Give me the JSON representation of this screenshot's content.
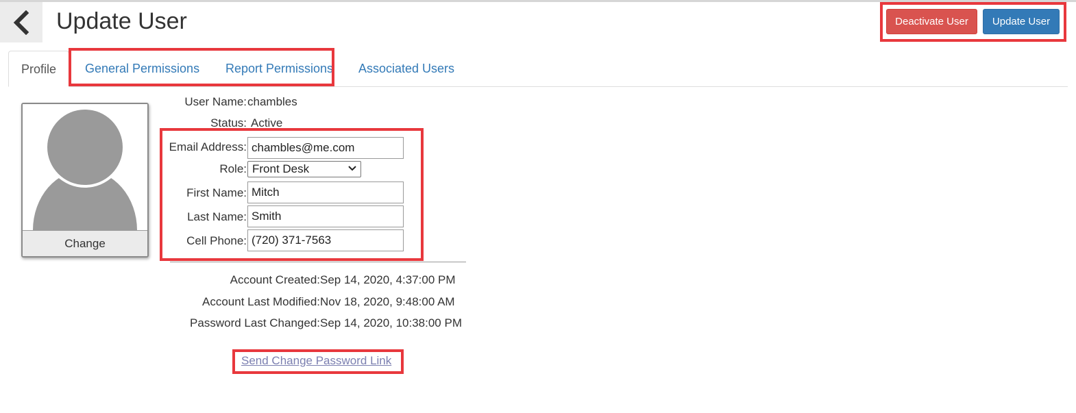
{
  "header": {
    "title": "Update User",
    "deactivate_label": "Deactivate User",
    "update_label": "Update User"
  },
  "tabs": [
    {
      "label": "Profile",
      "active": true
    },
    {
      "label": "General Permissions",
      "active": false
    },
    {
      "label": "Report Permissions",
      "active": false
    },
    {
      "label": "Associated Users",
      "active": false
    }
  ],
  "avatar": {
    "change_label": "Change"
  },
  "profile": {
    "username_label": "User Name:",
    "username": "chambles",
    "status_label": "Status:",
    "status": "Active",
    "email_label": "Email Address:",
    "email": "chambles@me.com",
    "role_label": "Role:",
    "role": "Front Desk",
    "first_name_label": "First Name:",
    "first_name": "Mitch",
    "last_name_label": "Last Name:",
    "last_name": "Smith",
    "cell_label": "Cell Phone:",
    "cell": "(720) 371-7563"
  },
  "meta": {
    "created_label": "Account Created:",
    "created": "Sep 14, 2020, 4:37:00 PM",
    "modified_label": "Account Last Modified:",
    "modified": "Nov 18, 2020, 9:48:00 AM",
    "password_label": "Password Last Changed:",
    "password": "Sep 14, 2020, 10:38:00 PM"
  },
  "send_link_label": "Send Change Password Link",
  "colors": {
    "danger": "#d9534f",
    "primary": "#337ab7",
    "highlight": "#e8383d",
    "link": "#337ab7"
  },
  "icons": {
    "back": "chevron-left-icon",
    "avatar": "user-silhouette-icon",
    "select": "chevron-down-icon"
  }
}
